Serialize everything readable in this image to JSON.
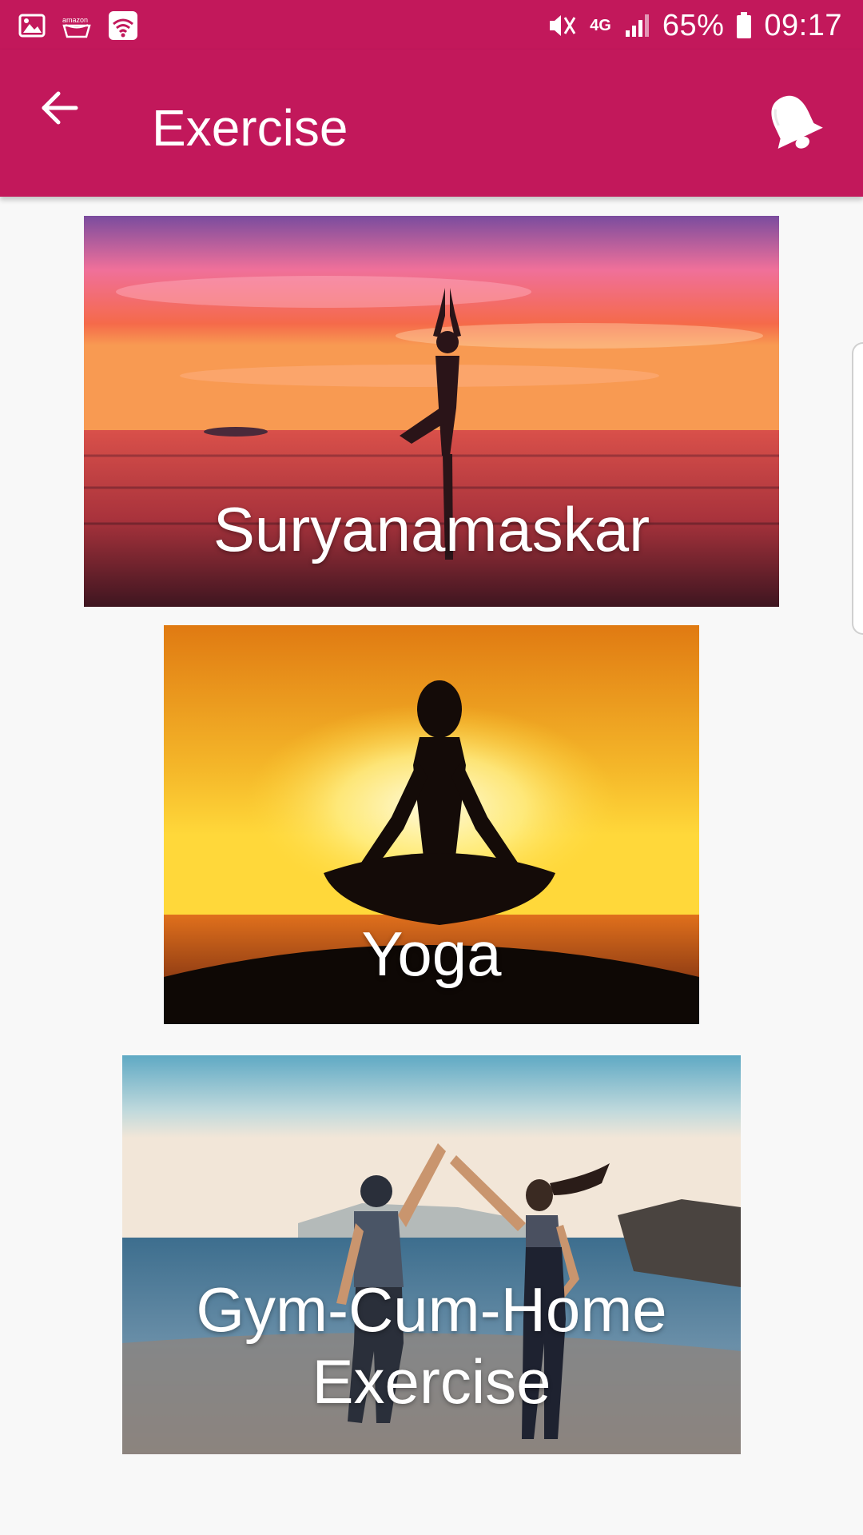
{
  "status_bar": {
    "left_icons": [
      "gallery-icon",
      "amazon-icon",
      "wifi-icon"
    ],
    "network_type": "4G",
    "battery_percent": "65%",
    "time": "09:17"
  },
  "app_bar": {
    "title": "Exercise",
    "back_icon": "arrow-back-icon",
    "notification_icon": "bell-icon"
  },
  "cards": [
    {
      "label": "Suryanamaskar"
    },
    {
      "label": "Yoga"
    },
    {
      "label_line1": "Gym-Cum-Home",
      "label_line2": "Exercise"
    }
  ],
  "colors": {
    "primary": "#c2185b",
    "background": "#f8f8f8",
    "text_on_primary": "#ffffff"
  }
}
